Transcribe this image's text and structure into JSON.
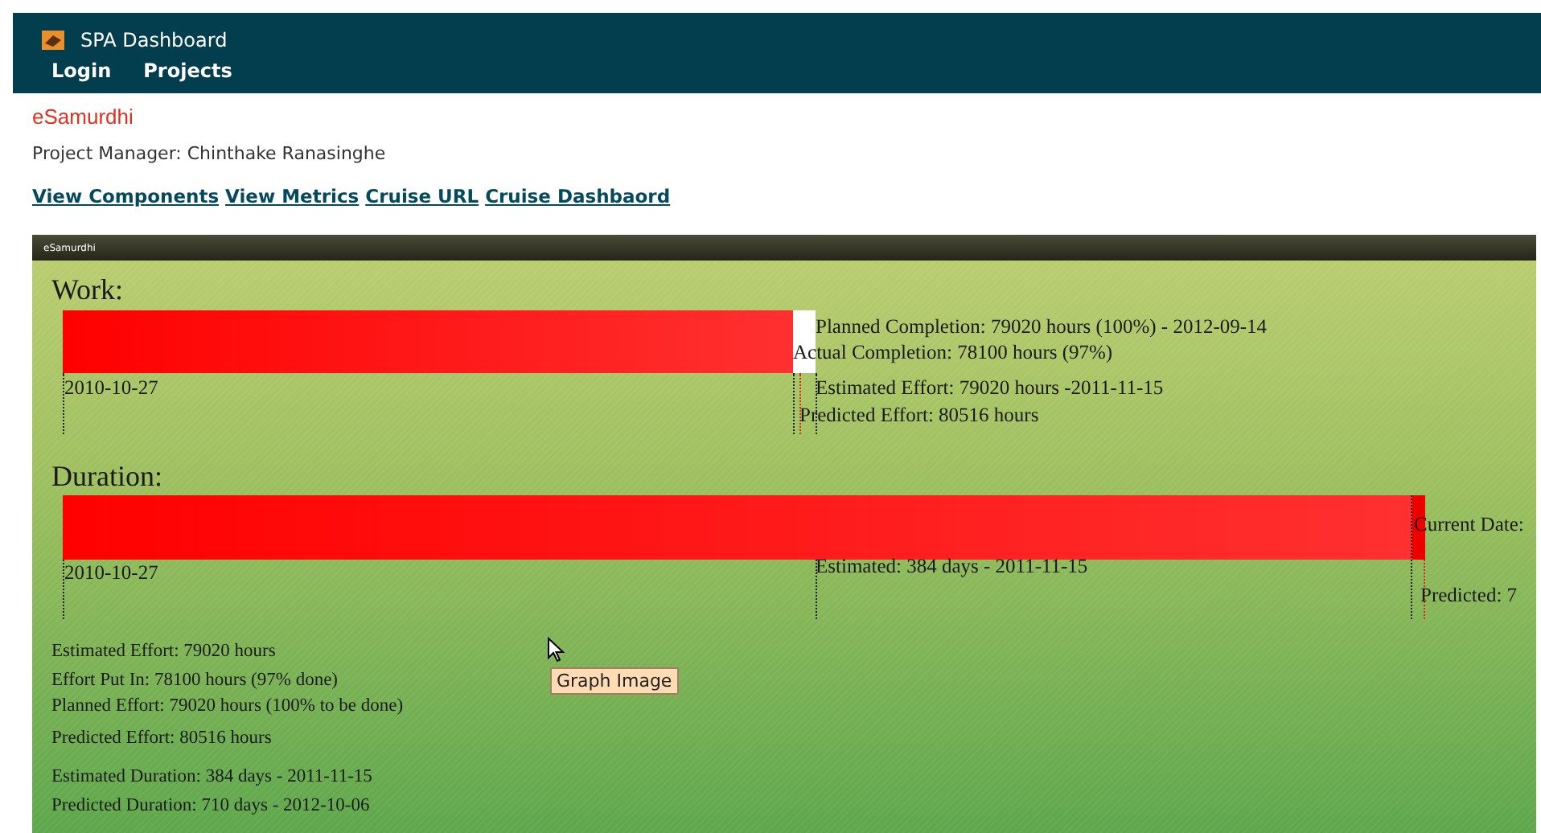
{
  "header": {
    "title": "SPA Dashboard",
    "nav": [
      "Login",
      "Projects"
    ]
  },
  "project": {
    "name": "eSamurdhi",
    "manager": "Project Manager: Chinthake Ranasinghe"
  },
  "links": [
    "View Components",
    "View Metrics",
    "Cruise URL",
    "Cruise Dashbaord"
  ],
  "graph": {
    "title": "eSamurdhi",
    "work": {
      "heading": "Work:",
      "level": 0.97,
      "start": "2010-10-27",
      "planned": "Planned Completion: 79020 hours (100%) - 2012-09-14",
      "actual": "Actual Completion: 78100 hours (97%)",
      "estimated": "Estimated Effort: 79020 hours -2011-11-15",
      "predicted": "Predicted Effort: 80516 hours"
    },
    "duration": {
      "heading": "Duration:",
      "level": 0.99,
      "start": "2010-10-27",
      "estimated": "Estimated: 384 days - 2011-11-15",
      "current": "Current Date:",
      "predicted": "Predicted: 7"
    },
    "summary": [
      "Estimated Effort:  79020 hours",
      "Effort Put In:  78100 hours (97% done)",
      "Planned Effort:  79020 hours (100% to be done)",
      "Predicted Effort:  80516 hours",
      "Estimated Duration:  384 days - 2011-11-15",
      "Predicted Duration:  710 days - 2012-10-06"
    ]
  },
  "tooltip": "Graph Image"
}
